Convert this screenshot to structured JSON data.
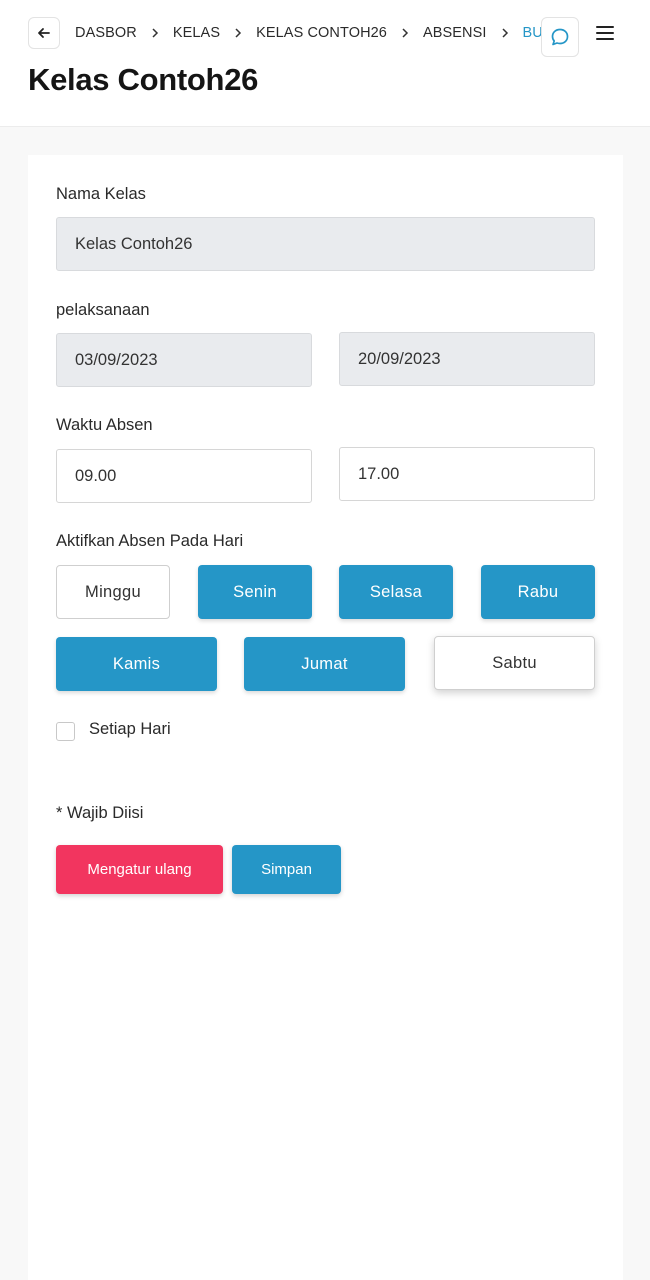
{
  "header": {
    "breadcrumb": [
      "DASBOR",
      "KELAS",
      "KELAS CONTOH26",
      "ABSENSI",
      "BUAT"
    ],
    "title": "Kelas Contoh26"
  },
  "form": {
    "class_name": {
      "label": "Nama Kelas",
      "value": "Kelas Contoh26"
    },
    "period": {
      "label": "pelaksanaan",
      "start": "03/09/2023",
      "end": "20/09/2023"
    },
    "time": {
      "label": "Waktu Absen",
      "start": "09.00",
      "end": "17.00"
    },
    "days": {
      "label": "Aktifkan Absen Pada Hari",
      "items": [
        {
          "label": "Minggu",
          "active": false
        },
        {
          "label": "Senin",
          "active": true
        },
        {
          "label": "Selasa",
          "active": true
        },
        {
          "label": "Rabu",
          "active": true
        },
        {
          "label": "Kamis",
          "active": true
        },
        {
          "label": "Jumat",
          "active": true
        },
        {
          "label": "Sabtu",
          "active": false
        }
      ]
    },
    "every_day": {
      "label": "Setiap Hari",
      "checked": false
    },
    "required_note": "* Wajib Diisi",
    "reset_label": "Mengatur ulang",
    "save_label": "Simpan"
  },
  "colors": {
    "accent": "#2596c7",
    "danger": "#f2355f",
    "disabled_bg": "#e9ebee"
  },
  "icons": [
    "arrow-left-icon",
    "chevron-right-icon",
    "chat-bubble-icon",
    "hamburger-menu-icon"
  ]
}
